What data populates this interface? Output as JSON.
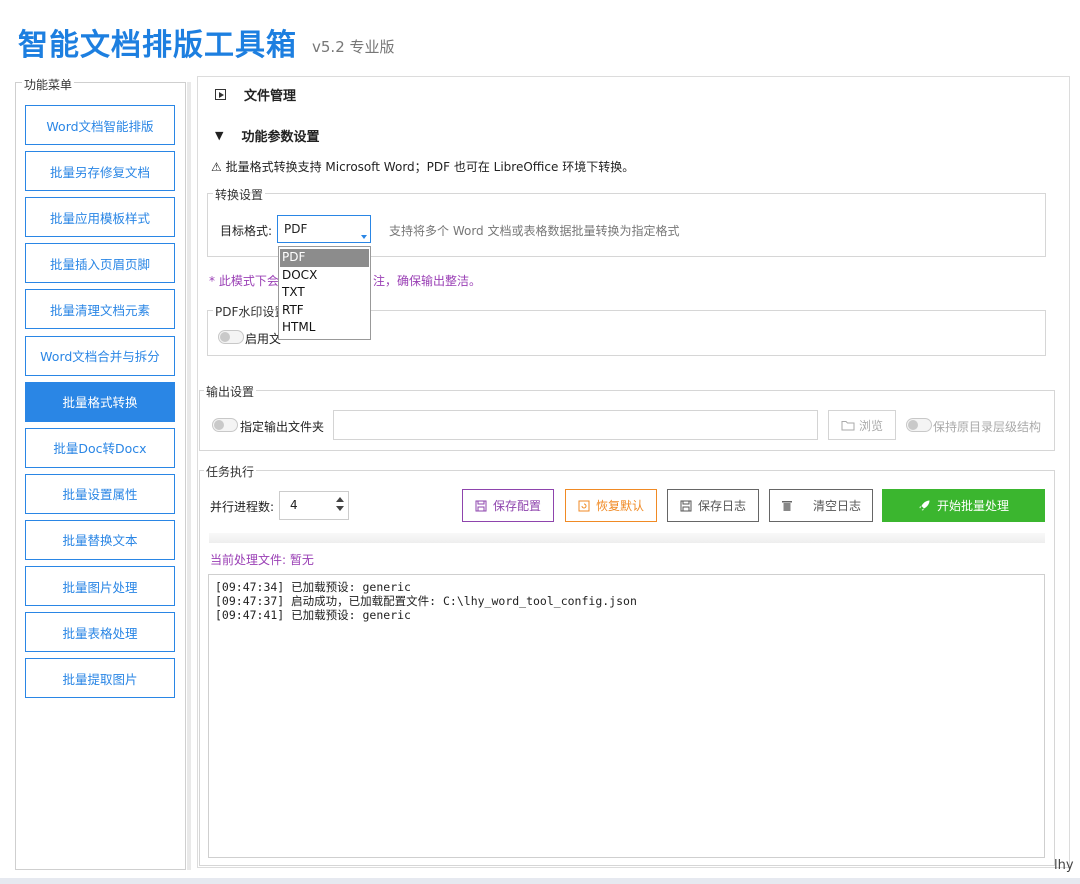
{
  "header": {
    "title": "智能文档排版工具箱",
    "version": "v5.2 专业版"
  },
  "sidebar": {
    "legend": "功能菜单",
    "items": [
      {
        "label": "Word文档智能排版"
      },
      {
        "label": "批量另存修复文档"
      },
      {
        "label": "批量应用模板样式"
      },
      {
        "label": "批量插入页眉页脚"
      },
      {
        "label": "批量清理文档元素"
      },
      {
        "label": "Word文档合并与拆分"
      },
      {
        "label": "批量格式转换",
        "active": true
      },
      {
        "label": "批量Doc转Docx"
      },
      {
        "label": "批量设置属性"
      },
      {
        "label": "批量替换文本"
      },
      {
        "label": "批量图片处理"
      },
      {
        "label": "批量表格处理"
      },
      {
        "label": "批量提取图片"
      }
    ]
  },
  "sections": {
    "file_mgmt": "文件管理",
    "params": "功能参数设置"
  },
  "notice": "⚠ 批量格式转换支持 Microsoft Word；PDF 也可在 LibreOffice 环境下转换。",
  "convert": {
    "legend": "转换设置",
    "target_label": "目标格式:",
    "selected": "PDF",
    "options": [
      "PDF",
      "DOCX",
      "TXT",
      "RTF",
      "HTML"
    ],
    "hint": "支持将多个 Word 文档或表格数据批量转换为指定格式",
    "note_left": "* 此模式下会",
    "note_right": "注，确保输出整洁。"
  },
  "watermark": {
    "legend": "PDF水印设置",
    "toggle_label": "启用文"
  },
  "output": {
    "legend": "输出设置",
    "toggle_label": "指定输出文件夹",
    "path_value": "",
    "browse_label": "浏览",
    "keep_structure_label": "保持原目录层级结构"
  },
  "task": {
    "legend": "任务执行",
    "parallel_label": "并行进程数:",
    "parallel_value": "4",
    "buttons": {
      "save_config": "保存配置",
      "restore_default": "恢复默认",
      "save_log": "保存日志",
      "clear_log": "清空日志",
      "start": "开始批量处理"
    },
    "current_file": "当前处理文件: 暂无",
    "log": [
      "[09:47:34] 已加载预设: generic",
      "[09:47:37] 启动成功，已加载配置文件: C:\\lhy_word_tool_config.json",
      "[09:47:41] 已加载预设: generic"
    ]
  },
  "corner_tag": "lhy",
  "colors": {
    "primary": "#2a86e5",
    "purple": "#8e44ad",
    "orange": "#f08a24",
    "green": "#3bb62f"
  }
}
